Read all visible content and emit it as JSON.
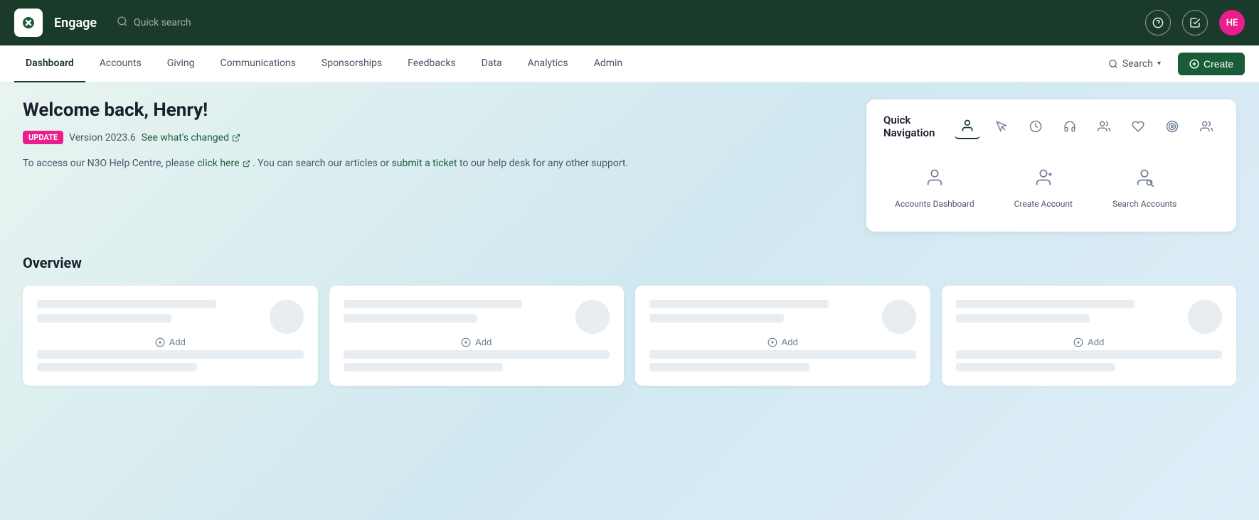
{
  "topbar": {
    "brand": "Engage",
    "search_placeholder": "Quick search",
    "avatar_initials": "HE"
  },
  "navbar": {
    "items": [
      {
        "label": "Dashboard",
        "active": true
      },
      {
        "label": "Accounts",
        "active": false
      },
      {
        "label": "Giving",
        "active": false
      },
      {
        "label": "Communications",
        "active": false
      },
      {
        "label": "Sponsorships",
        "active": false
      },
      {
        "label": "Feedbacks",
        "active": false
      },
      {
        "label": "Data",
        "active": false
      },
      {
        "label": "Analytics",
        "active": false
      },
      {
        "label": "Admin",
        "active": false
      }
    ],
    "search_label": "Search",
    "create_label": "Create"
  },
  "welcome": {
    "title": "Welcome back, Henry!",
    "update_tag": "UPDATE",
    "version": "Version 2023.6",
    "whats_changed": "See what's changed",
    "help_text_1": "To access our N3O Help Centre, please",
    "click_here": "click here",
    "help_text_2": ". You can search our articles or",
    "submit_ticket": "submit a ticket",
    "help_text_3": " to our help desk for any other support."
  },
  "quick_nav": {
    "title": "Quick Navigation",
    "icons": [
      {
        "name": "person-icon",
        "label": "person"
      },
      {
        "name": "cursor-icon",
        "label": "cursor"
      },
      {
        "name": "clock-icon",
        "label": "clock"
      },
      {
        "name": "headset-icon",
        "label": "headset"
      },
      {
        "name": "users-icon",
        "label": "users"
      },
      {
        "name": "heart-icon",
        "label": "heart"
      },
      {
        "name": "target-icon",
        "label": "target"
      },
      {
        "name": "team-icon",
        "label": "team"
      }
    ],
    "items": [
      {
        "label": "Accounts Dashboard",
        "icon": "person-dashboard-icon"
      },
      {
        "label": "Create Account",
        "icon": "person-add-icon"
      },
      {
        "label": "Search Accounts",
        "icon": "person-search-icon"
      }
    ]
  },
  "overview": {
    "title": "Overview",
    "add_label": "Add",
    "cards": [
      {
        "id": 1
      },
      {
        "id": 2
      },
      {
        "id": 3
      },
      {
        "id": 4
      }
    ]
  }
}
